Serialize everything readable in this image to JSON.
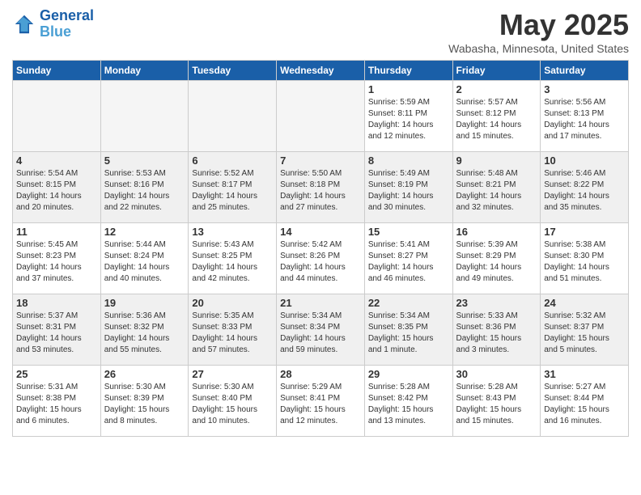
{
  "logo": {
    "line1": "General",
    "line2": "Blue"
  },
  "title": "May 2025",
  "location": "Wabasha, Minnesota, United States",
  "days_of_week": [
    "Sunday",
    "Monday",
    "Tuesday",
    "Wednesday",
    "Thursday",
    "Friday",
    "Saturday"
  ],
  "weeks": [
    [
      {
        "day": "",
        "empty": true
      },
      {
        "day": "",
        "empty": true
      },
      {
        "day": "",
        "empty": true
      },
      {
        "day": "",
        "empty": true
      },
      {
        "day": "1",
        "sunrise": "5:59 AM",
        "sunset": "8:11 PM",
        "daylight": "14 hours and 12 minutes."
      },
      {
        "day": "2",
        "sunrise": "5:57 AM",
        "sunset": "8:12 PM",
        "daylight": "14 hours and 15 minutes."
      },
      {
        "day": "3",
        "sunrise": "5:56 AM",
        "sunset": "8:13 PM",
        "daylight": "14 hours and 17 minutes."
      }
    ],
    [
      {
        "day": "4",
        "sunrise": "5:54 AM",
        "sunset": "8:15 PM",
        "daylight": "14 hours and 20 minutes."
      },
      {
        "day": "5",
        "sunrise": "5:53 AM",
        "sunset": "8:16 PM",
        "daylight": "14 hours and 22 minutes."
      },
      {
        "day": "6",
        "sunrise": "5:52 AM",
        "sunset": "8:17 PM",
        "daylight": "14 hours and 25 minutes."
      },
      {
        "day": "7",
        "sunrise": "5:50 AM",
        "sunset": "8:18 PM",
        "daylight": "14 hours and 27 minutes."
      },
      {
        "day": "8",
        "sunrise": "5:49 AM",
        "sunset": "8:19 PM",
        "daylight": "14 hours and 30 minutes."
      },
      {
        "day": "9",
        "sunrise": "5:48 AM",
        "sunset": "8:21 PM",
        "daylight": "14 hours and 32 minutes."
      },
      {
        "day": "10",
        "sunrise": "5:46 AM",
        "sunset": "8:22 PM",
        "daylight": "14 hours and 35 minutes."
      }
    ],
    [
      {
        "day": "11",
        "sunrise": "5:45 AM",
        "sunset": "8:23 PM",
        "daylight": "14 hours and 37 minutes."
      },
      {
        "day": "12",
        "sunrise": "5:44 AM",
        "sunset": "8:24 PM",
        "daylight": "14 hours and 40 minutes."
      },
      {
        "day": "13",
        "sunrise": "5:43 AM",
        "sunset": "8:25 PM",
        "daylight": "14 hours and 42 minutes."
      },
      {
        "day": "14",
        "sunrise": "5:42 AM",
        "sunset": "8:26 PM",
        "daylight": "14 hours and 44 minutes."
      },
      {
        "day": "15",
        "sunrise": "5:41 AM",
        "sunset": "8:27 PM",
        "daylight": "14 hours and 46 minutes."
      },
      {
        "day": "16",
        "sunrise": "5:39 AM",
        "sunset": "8:29 PM",
        "daylight": "14 hours and 49 minutes."
      },
      {
        "day": "17",
        "sunrise": "5:38 AM",
        "sunset": "8:30 PM",
        "daylight": "14 hours and 51 minutes."
      }
    ],
    [
      {
        "day": "18",
        "sunrise": "5:37 AM",
        "sunset": "8:31 PM",
        "daylight": "14 hours and 53 minutes."
      },
      {
        "day": "19",
        "sunrise": "5:36 AM",
        "sunset": "8:32 PM",
        "daylight": "14 hours and 55 minutes."
      },
      {
        "day": "20",
        "sunrise": "5:35 AM",
        "sunset": "8:33 PM",
        "daylight": "14 hours and 57 minutes."
      },
      {
        "day": "21",
        "sunrise": "5:34 AM",
        "sunset": "8:34 PM",
        "daylight": "14 hours and 59 minutes."
      },
      {
        "day": "22",
        "sunrise": "5:34 AM",
        "sunset": "8:35 PM",
        "daylight": "15 hours and 1 minute."
      },
      {
        "day": "23",
        "sunrise": "5:33 AM",
        "sunset": "8:36 PM",
        "daylight": "15 hours and 3 minutes."
      },
      {
        "day": "24",
        "sunrise": "5:32 AM",
        "sunset": "8:37 PM",
        "daylight": "15 hours and 5 minutes."
      }
    ],
    [
      {
        "day": "25",
        "sunrise": "5:31 AM",
        "sunset": "8:38 PM",
        "daylight": "15 hours and 6 minutes."
      },
      {
        "day": "26",
        "sunrise": "5:30 AM",
        "sunset": "8:39 PM",
        "daylight": "15 hours and 8 minutes."
      },
      {
        "day": "27",
        "sunrise": "5:30 AM",
        "sunset": "8:40 PM",
        "daylight": "15 hours and 10 minutes."
      },
      {
        "day": "28",
        "sunrise": "5:29 AM",
        "sunset": "8:41 PM",
        "daylight": "15 hours and 12 minutes."
      },
      {
        "day": "29",
        "sunrise": "5:28 AM",
        "sunset": "8:42 PM",
        "daylight": "15 hours and 13 minutes."
      },
      {
        "day": "30",
        "sunrise": "5:28 AM",
        "sunset": "8:43 PM",
        "daylight": "15 hours and 15 minutes."
      },
      {
        "day": "31",
        "sunrise": "5:27 AM",
        "sunset": "8:44 PM",
        "daylight": "15 hours and 16 minutes."
      }
    ]
  ]
}
